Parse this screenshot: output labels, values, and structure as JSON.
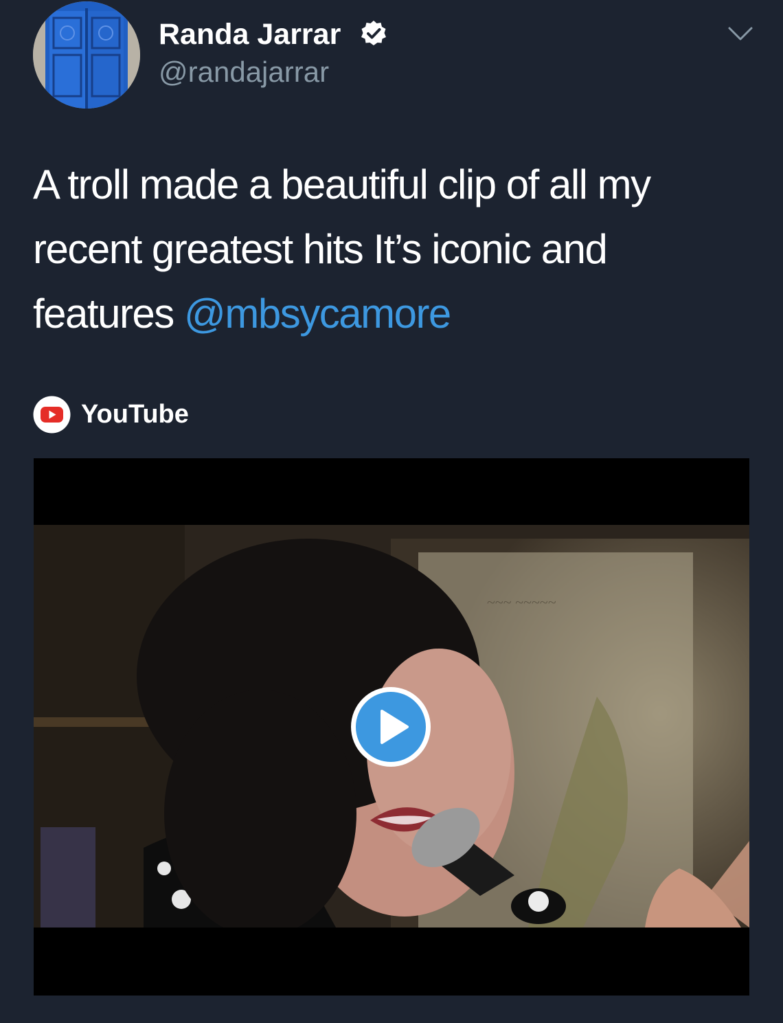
{
  "author": {
    "name": "Randa Jarrar",
    "handle": "@randajarrar",
    "verified": true
  },
  "tweet": {
    "text_before_mention": "A troll made a beautiful clip of all my recent greatest hits It’s iconic and features ",
    "mention": "@mbsycamore"
  },
  "card": {
    "source_label": "YouTube",
    "source_icon": "youtube-icon",
    "play_icon": "play-icon"
  },
  "icons": {
    "verified": "verified-badge-icon",
    "menu": "chevron-down-icon"
  },
  "colors": {
    "background": "#1c2330",
    "text": "#ffffff",
    "secondary_text": "#8899a6",
    "mention": "#3d98e0",
    "youtube_red": "#e52d27",
    "play_button": "#3d98e0"
  }
}
